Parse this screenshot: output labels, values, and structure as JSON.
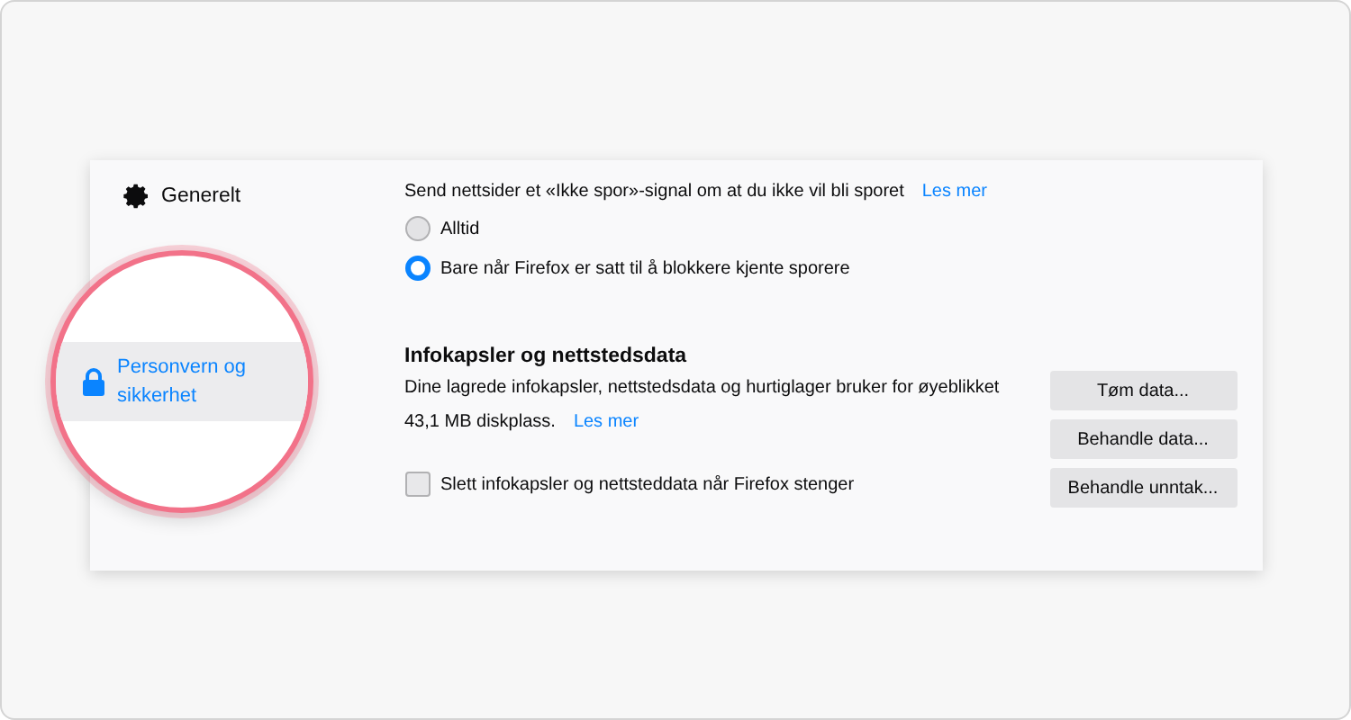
{
  "sidebar": {
    "items": [
      {
        "label": "Generelt",
        "kind": "gear",
        "selected": false
      },
      {
        "label": "Personvern og sikkerhet",
        "kind": "lock",
        "selected": true
      }
    ]
  },
  "dnt": {
    "label": "Send nettsider et «Ikke spor»-signal om at du ikke vil bli sporet",
    "link": "Les mer",
    "options": [
      {
        "label": "Alltid",
        "selected": false
      },
      {
        "label": "Bare når Firefox er satt til å blokkere kjente sporere",
        "selected": true
      }
    ]
  },
  "cookies": {
    "heading": "Infokapsler og nettstedsdata",
    "description": "Dine lagrede infokapsler, nettstedsdata og hurtiglager bruker for øyeblikket",
    "usage": "43,1 MB diskplass.",
    "link": "Les mer",
    "checkbox": {
      "label": "Slett infokapsler og nettsteddata når Firefox stenger",
      "checked": false
    },
    "buttons": [
      "Tøm data...",
      "Behandle data...",
      "Behandle unntak..."
    ]
  }
}
